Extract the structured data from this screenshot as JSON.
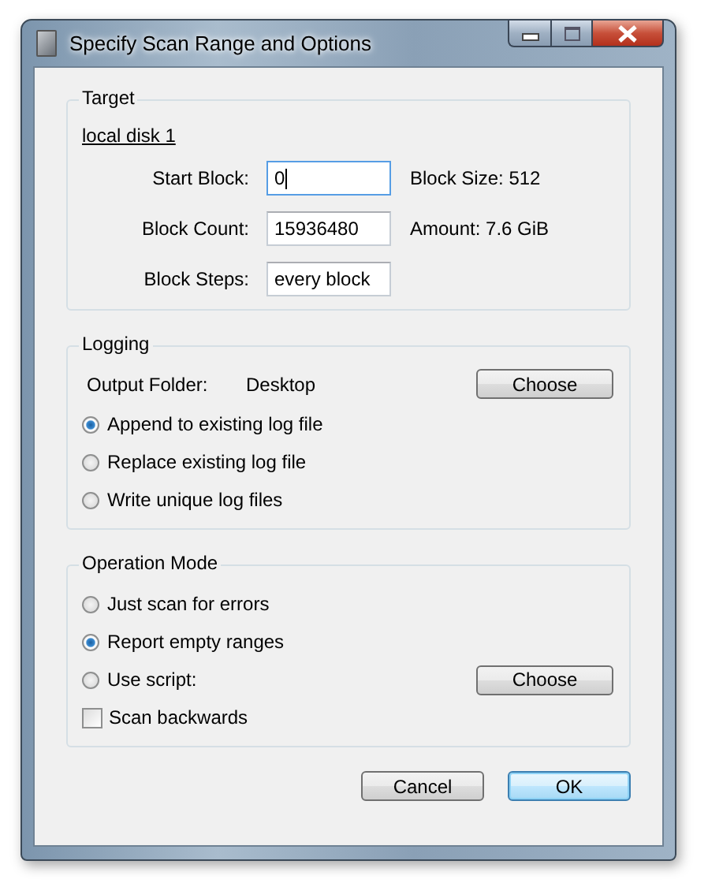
{
  "window": {
    "title": "Specify Scan Range and Options"
  },
  "target": {
    "legend": "Target",
    "disk_link": "local disk 1",
    "fields": [
      {
        "label": "Start Block:",
        "value": "0",
        "focused": true,
        "info": "Block Size: 512"
      },
      {
        "label": "Block Count:",
        "value": "15936480",
        "focused": false,
        "info": "Amount: 7.6 GiB"
      },
      {
        "label": "Block Steps:",
        "value": "every block",
        "focused": false
      }
    ]
  },
  "logging": {
    "legend": "Logging",
    "output_folder": {
      "label": "Output Folder:",
      "value": "Desktop",
      "button": "Choose"
    },
    "options": [
      {
        "label": "Append to existing log file",
        "selected": true
      },
      {
        "label": "Replace existing log file",
        "selected": false
      },
      {
        "label": "Write unique log files",
        "selected": false
      }
    ]
  },
  "operation_mode": {
    "legend": "Operation Mode",
    "options": [
      {
        "kind": "radio",
        "label": "Just scan for errors",
        "selected": false
      },
      {
        "kind": "radio",
        "label": "Report empty ranges",
        "selected": true
      },
      {
        "kind": "radio",
        "label": "Use script:",
        "selected": false,
        "button": "Choose"
      },
      {
        "kind": "checkbox",
        "label": "Scan backwards",
        "checked": false
      }
    ]
  },
  "buttons": [
    {
      "label": "Cancel",
      "default": false
    },
    {
      "label": "OK",
      "default": true
    }
  ]
}
